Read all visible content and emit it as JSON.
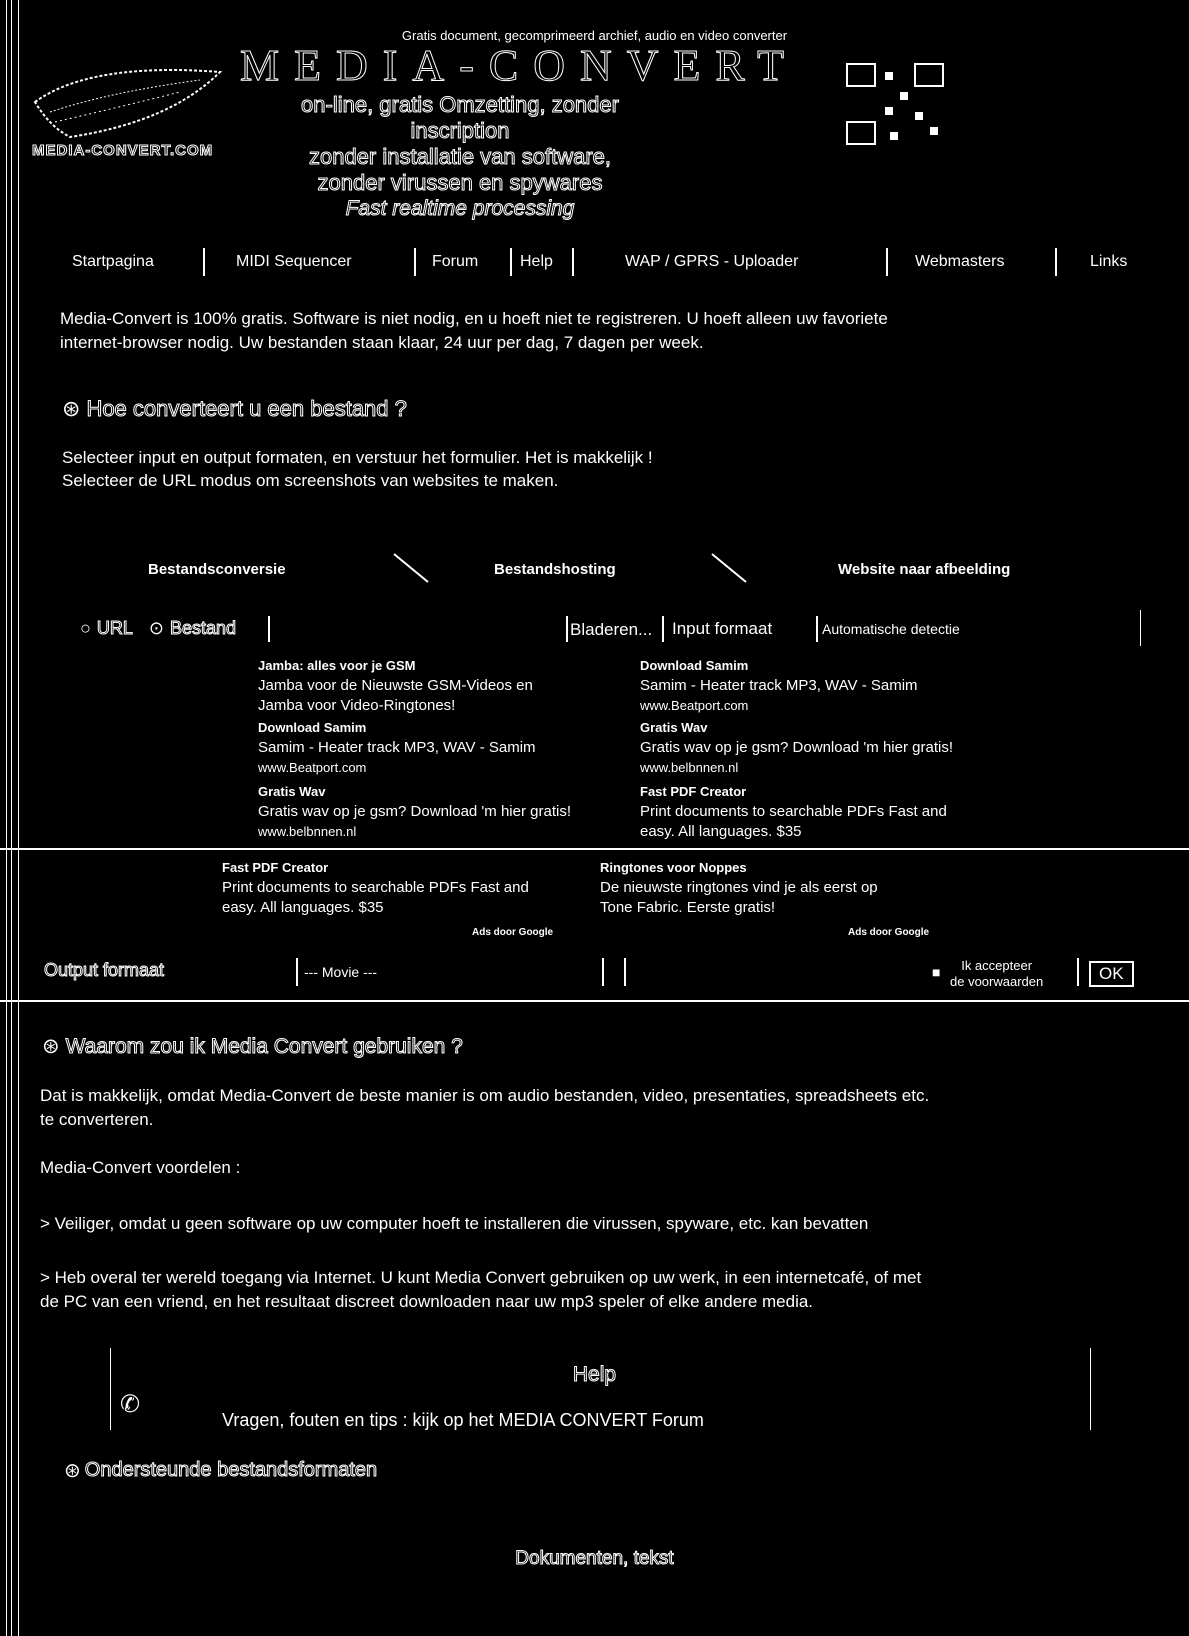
{
  "header": {
    "tagline": "Gratis document, gecomprimeerd archief, audio en video converter",
    "logo_text": "MEDIA-CONVERT",
    "site_label": "MEDIA-CONVERT.COM",
    "lines": [
      "on-line, gratis Omzetting, zonder",
      "inscription",
      "zonder installatie van software,",
      "zonder virussen en spywares"
    ],
    "italic_line": "Fast realtime processing"
  },
  "nav": {
    "items": [
      "Startpagina",
      "MIDI Sequencer",
      "Forum",
      "Help",
      "WAP / GPRS - Uploader",
      "Webmasters",
      "Links"
    ]
  },
  "intro": {
    "line1": "Media-Convert is 100% gratis. Software is niet nodig, en u hoeft niet te registreren. U hoeft alleen uw favoriete",
    "line2": "internet-browser nodig. Uw bestanden staan klaar, 24 uur per dag, 7 dagen per week."
  },
  "howto": {
    "heading": "Hoe converteert u een bestand ?",
    "line1": "Selecteer input en output formaten, en verstuur het formulier. Het is makkelijk !",
    "line2": "Selecteer de URL modus om screenshots van websites te maken."
  },
  "tabs": [
    "Bestandsconversie",
    "Bestandshosting",
    "Website naar afbeelding"
  ],
  "form": {
    "url_label": "URL",
    "file_label": "Bestand",
    "browse_button": "Bladeren...",
    "input_format_label": "Input formaat",
    "input_format_value": "Automatische detectie",
    "output_format_label": "Output formaat",
    "output_format_value": "--- Movie ---",
    "accept_label_1": "Ik accepteer",
    "accept_label_2": "de voorwaarden",
    "ok_button": "OK"
  },
  "ads_top": {
    "left": [
      {
        "title": "Jamba: alles voor je GSM",
        "lines": [
          "Jamba voor de Nieuwste GSM-Videos en",
          "Jamba voor Video-Ringtones!"
        ],
        "url": ""
      },
      {
        "title": "Download Samim",
        "lines": [
          "Samim - Heater track MP3, WAV - Samim"
        ],
        "url": "www.Beatport.com"
      },
      {
        "title": "Gratis Wav",
        "lines": [
          "Gratis wav op je gsm? Download 'm hier gratis!"
        ],
        "url": "www.belbnnen.nl"
      }
    ],
    "right": [
      {
        "title": "Download Samim",
        "lines": [
          "Samim - Heater track MP3, WAV - Samim"
        ],
        "url": "www.Beatport.com"
      },
      {
        "title": "Gratis Wav",
        "lines": [
          "Gratis wav op je gsm? Download 'm hier gratis!"
        ],
        "url": "www.belbnnen.nl"
      },
      {
        "title": "Fast PDF Creator",
        "lines": [
          "Print documents to searchable PDFs Fast and",
          "easy. All languages. $35"
        ],
        "url": ""
      }
    ]
  },
  "ads_bottom": {
    "left": {
      "title": "Fast PDF Creator",
      "lines": [
        "Print documents to searchable PDFs Fast and",
        "easy. All languages. $35"
      ]
    },
    "right": {
      "title": "Ringtones voor Noppes",
      "lines": [
        "De nieuwste ringtones vind je als eerst op",
        "Tone Fabric. Eerste gratis!"
      ]
    },
    "google_label": "Ads door Google"
  },
  "why": {
    "heading": "Waarom zou ik Media Convert gebruiken ?",
    "p1_line1": "Dat is makkelijk, omdat Media-Convert de beste manier is om audio bestanden, video, presentaties, spreadsheets etc.",
    "p1_line2": "te converteren.",
    "advantages_label": "Media-Convert voordelen :",
    "p2": "> Veiliger, omdat u geen software op uw computer hoeft te installeren die virussen, spyware, etc. kan bevatten",
    "p3_line1": "> Heb overal ter wereld toegang via Internet. U kunt Media Convert gebruiken op uw werk, in een internetcafé, of met",
    "p3_line2": "de PC van een vriend, en het resultaat discreet downloaden naar uw mp3 speler of elke andere media."
  },
  "help": {
    "title": "Help",
    "text": "Vragen, fouten en tips : kijk op het MEDIA CONVERT Forum"
  },
  "formats": {
    "heading": "Ondersteunde bestandsformaten",
    "sub": "Dokumenten, tekst"
  },
  "colors": {
    "background": "#000000",
    "foreground": "#ffffff"
  },
  "icons": [
    "logo-feather-icon",
    "qr-code-icon",
    "question-icon",
    "help-icon",
    "radio-icon"
  ]
}
